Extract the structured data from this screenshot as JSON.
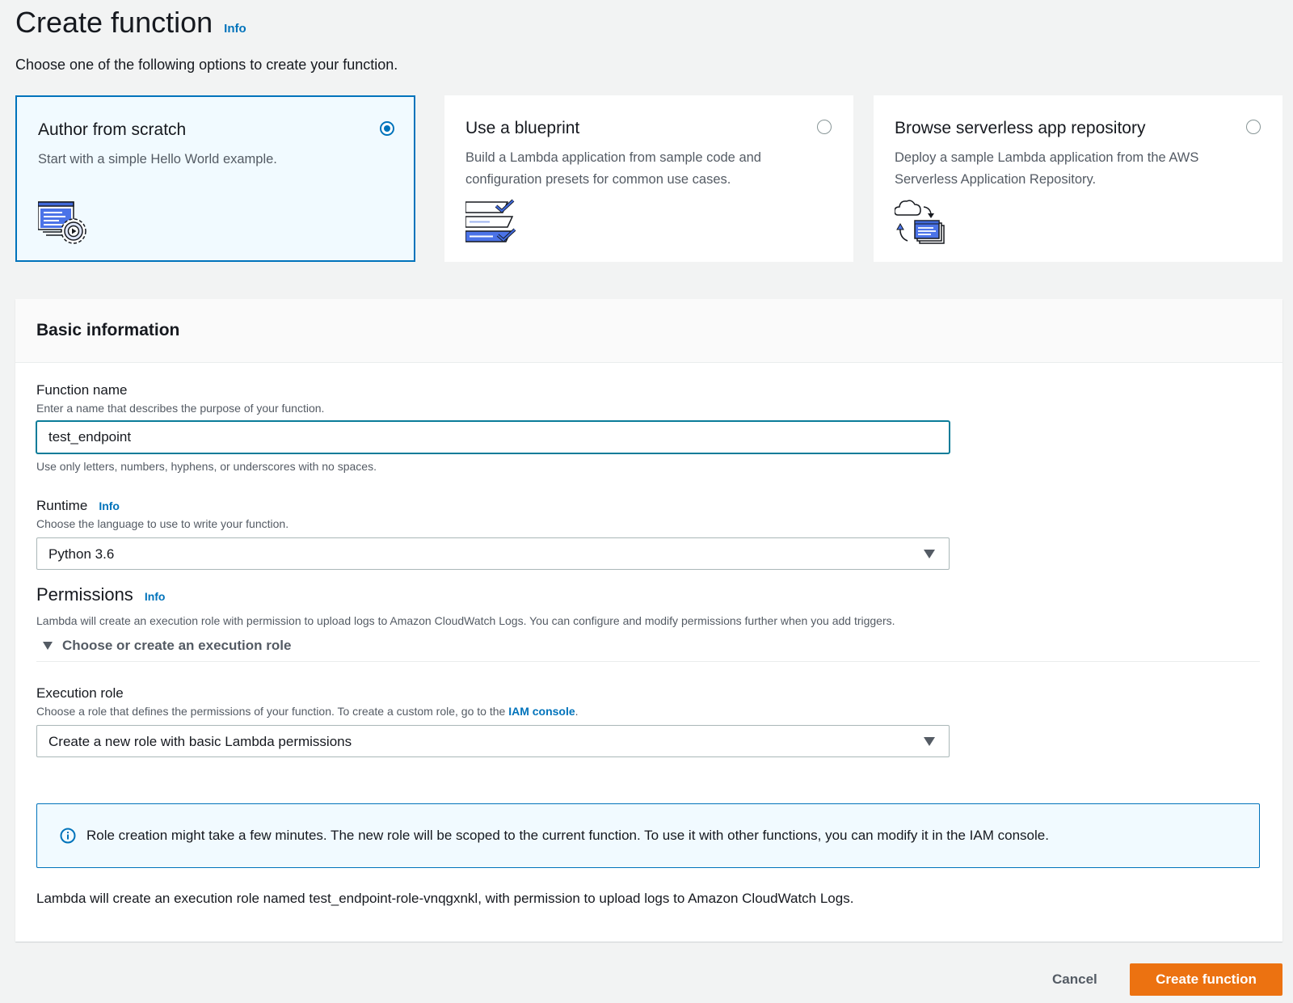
{
  "header": {
    "title": "Create function",
    "info": "Info",
    "subtitle": "Choose one of the following options to create your function."
  },
  "options": [
    {
      "title": "Author from scratch",
      "description": "Start with a simple Hello World example.",
      "selected": true,
      "icon": "code-gear-icon"
    },
    {
      "title": "Use a blueprint",
      "description": "Build a Lambda application from sample code and configuration presets for common use cases.",
      "selected": false,
      "icon": "blueprint-checklist-icon"
    },
    {
      "title": "Browse serverless app repository",
      "description": "Deploy a sample Lambda application from the AWS Serverless Application Repository.",
      "selected": false,
      "icon": "cloud-repository-icon"
    }
  ],
  "basic_info": {
    "title": "Basic information",
    "function_name": {
      "label": "Function name",
      "description": "Enter a name that describes the purpose of your function.",
      "value": "test_endpoint",
      "constraint": "Use only letters, numbers, hyphens, or underscores with no spaces."
    },
    "runtime": {
      "label": "Runtime",
      "info": "Info",
      "description": "Choose the language to use to write your function.",
      "value": "Python 3.6"
    },
    "permissions": {
      "title": "Permissions",
      "info": "Info",
      "description": "Lambda will create an execution role with permission to upload logs to Amazon CloudWatch Logs. You can configure and modify permissions further when you add triggers.",
      "expander_label": "Choose or create an execution role"
    },
    "execution_role": {
      "label": "Execution role",
      "description_prefix": "Choose a role that defines the permissions of your function. To create a custom role, go to the ",
      "description_link": "IAM console",
      "description_suffix": ".",
      "value": "Create a new role with basic Lambda permissions"
    },
    "alert": "Role creation might take a few minutes. The new role will be scoped to the current function. To use it with other functions, you can modify it in the IAM console.",
    "role_note": "Lambda will create an execution role named test_endpoint-role-vnqgxnkl, with permission to upload logs to Amazon CloudWatch Logs."
  },
  "footer": {
    "cancel": "Cancel",
    "create": "Create function"
  },
  "colors": {
    "accent_blue": "#0073bb",
    "primary_orange": "#ec7211",
    "selected_tile_bg": "#f1faff",
    "page_bg": "#f2f3f3"
  }
}
